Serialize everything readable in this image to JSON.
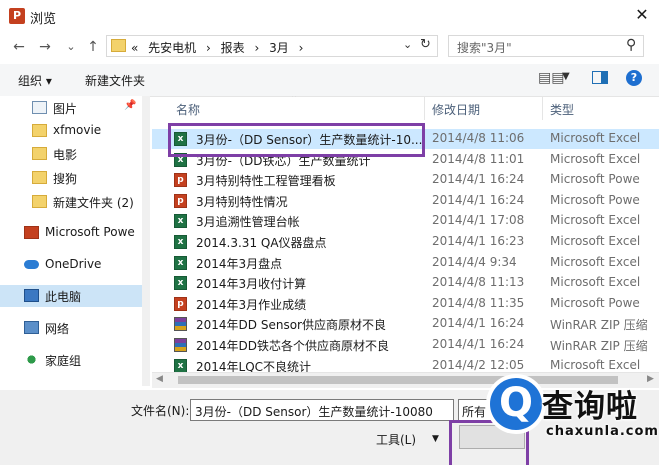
{
  "window": {
    "app_icon": "P",
    "title": "浏览",
    "close": "✕"
  },
  "nav": {
    "back": "←",
    "forward": "→",
    "down": "⌄",
    "up": "↑"
  },
  "address": {
    "crumbs": [
      "«",
      "先安电机",
      "›",
      "报表",
      "›",
      "3月",
      "›"
    ],
    "dropdown": "⌄",
    "refresh": "↻"
  },
  "search": {
    "placeholder": "搜索\"3月\"",
    "icon": "search-icon"
  },
  "toolbar": {
    "organize": "组织 ▾",
    "new_folder": "新建文件夹",
    "view_icon": "▤▤",
    "view_arrow": "▼",
    "help": "?"
  },
  "sidebar": {
    "items": [
      {
        "label": "图片",
        "icon": "pictures-icon",
        "pinned": true
      },
      {
        "label": "xfmovie",
        "icon": "folder-icon"
      },
      {
        "label": "电影",
        "icon": "folder-icon"
      },
      {
        "label": "搜狗",
        "icon": "folder-icon"
      },
      {
        "label": "新建文件夹 (2)",
        "icon": "folder-icon"
      },
      {
        "label": "Microsoft Powe",
        "icon": "powerpoint-icon"
      },
      {
        "label": "OneDrive",
        "icon": "onedrive-icon"
      },
      {
        "label": "此电脑",
        "icon": "computer-icon",
        "selected": true
      },
      {
        "label": "网络",
        "icon": "network-icon"
      },
      {
        "label": "家庭组",
        "icon": "homegroup-icon"
      }
    ]
  },
  "file_list": {
    "columns": {
      "name": "名称",
      "modified": "修改日期",
      "type": "类型"
    },
    "files": [
      {
        "name": "3月份-（DD Sensor）生产数量统计-10...",
        "modified": "2014/4/8 11:06",
        "type": "Microsoft Excel",
        "icon": "xls",
        "selected": true
      },
      {
        "name": "3月份-（DD铁芯）生产数量统计",
        "modified": "2014/4/8 11:01",
        "type": "Microsoft Excel",
        "icon": "xls"
      },
      {
        "name": "3月特别特性工程管理看板",
        "modified": "2014/4/1 16:24",
        "type": "Microsoft Powe",
        "icon": "ppt"
      },
      {
        "name": "3月特别特性情况",
        "modified": "2014/4/1 16:24",
        "type": "Microsoft Powe",
        "icon": "ppt"
      },
      {
        "name": "3月追溯性管理台帐",
        "modified": "2014/4/1 17:08",
        "type": "Microsoft Excel",
        "icon": "xls"
      },
      {
        "name": "2014.3.31 QA仪器盘点",
        "modified": "2014/4/1 16:23",
        "type": "Microsoft Excel",
        "icon": "xls"
      },
      {
        "name": "2014年3月盘点",
        "modified": "2014/4/4 9:34",
        "type": "Microsoft Excel",
        "icon": "xls"
      },
      {
        "name": "2014年3月收付计算",
        "modified": "2014/4/8 11:13",
        "type": "Microsoft Excel",
        "icon": "xls"
      },
      {
        "name": "2014年3月作业成绩",
        "modified": "2014/4/8 11:35",
        "type": "Microsoft Powe",
        "icon": "ppt"
      },
      {
        "name": "2014年DD Sensor供应商原材不良",
        "modified": "2014/4/1 16:24",
        "type": "WinRAR ZIP 压缩",
        "icon": "zip"
      },
      {
        "name": "2014年DD铁芯各个供应商原材不良",
        "modified": "2014/4/1 16:24",
        "type": "WinRAR ZIP 压缩",
        "icon": "zip"
      },
      {
        "name": "2014年LQC不良统计",
        "modified": "2014/4/2 12:05",
        "type": "Microsoft Excel",
        "icon": "xls"
      }
    ]
  },
  "bottom": {
    "filename_label": "文件名(N):",
    "filename_value": "3月份-（DD Sensor）生产数量统计-10080",
    "filter_value": "所有",
    "tools": "工具(L)",
    "tools_arrow": "▼"
  },
  "watermark": {
    "glyph": "Q",
    "text": "查询啦",
    "url": "chaxunla.com"
  },
  "colors": {
    "selection": "#cce8ff",
    "highlight": "#7e3fa6",
    "brand_blue": "#1e73d6"
  }
}
